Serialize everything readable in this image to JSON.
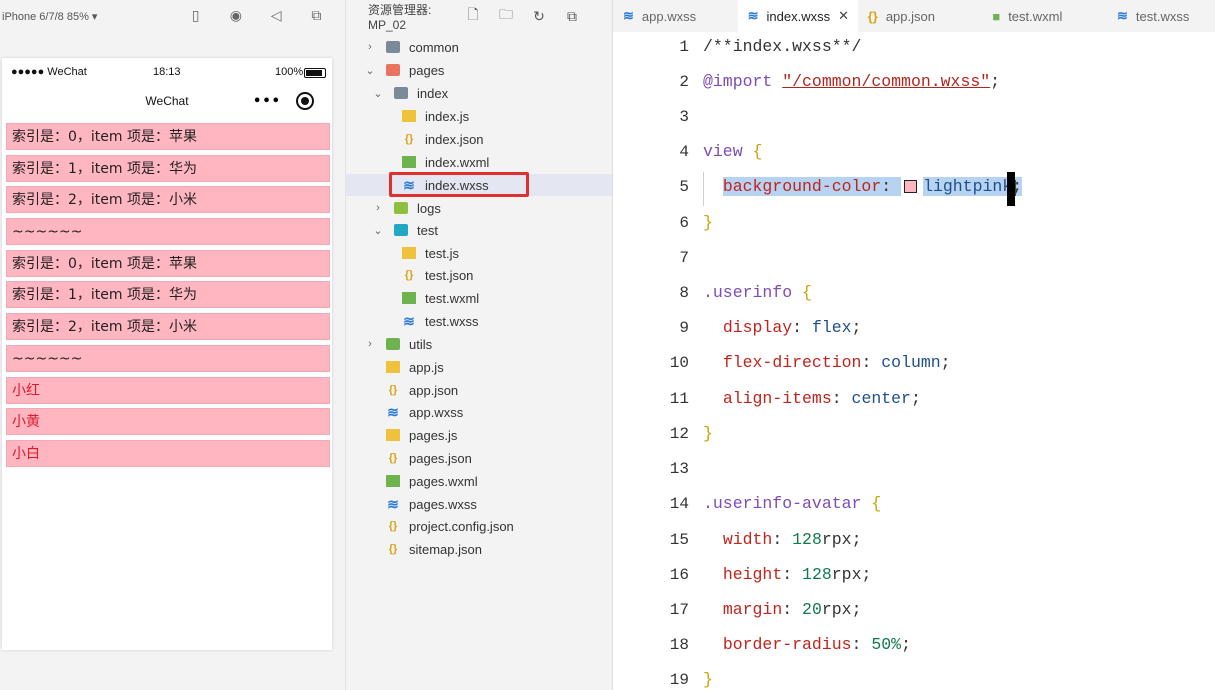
{
  "simulator": {
    "device_label": "iPhone 6/7/8 85% ▾",
    "status": {
      "carrier": "●●●●● WeChat",
      "time": "18:13",
      "battery": "100%"
    },
    "nav_title": "WeChat",
    "items": [
      {
        "text": "索引是：0，item 项是：苹果",
        "red": false
      },
      {
        "text": "索引是：1，item 项是：华为",
        "red": false
      },
      {
        "text": "索引是：2，item 项是：小米",
        "red": false
      },
      {
        "text": "~~~~~~",
        "red": false
      },
      {
        "text": "索引是：0，item 项是：苹果",
        "red": false
      },
      {
        "text": "索引是：1，item 项是：华为",
        "red": false
      },
      {
        "text": "索引是：2，item 项是：小米",
        "red": false
      },
      {
        "text": "~~~~~~",
        "red": false
      },
      {
        "text": "小红",
        "red": true
      },
      {
        "text": "小黄",
        "red": true
      },
      {
        "text": "小白",
        "red": true
      }
    ]
  },
  "explorer": {
    "title": "资源管理器: MP_02",
    "tree": [
      {
        "label": "common",
        "depth": 0,
        "kind": "fold-grey",
        "chev": "›"
      },
      {
        "label": "pages",
        "depth": 0,
        "kind": "fold-pages",
        "chev": "⌄"
      },
      {
        "label": "index",
        "depth": 1,
        "kind": "fold-index",
        "chev": "⌄"
      },
      {
        "label": "index.js",
        "depth": 2,
        "kind": "i-js",
        "chev": ""
      },
      {
        "label": "index.json",
        "depth": 2,
        "kind": "i-json",
        "chev": ""
      },
      {
        "label": "index.wxml",
        "depth": 2,
        "kind": "i-wxml",
        "chev": ""
      },
      {
        "label": "index.wxss",
        "depth": 2,
        "kind": "i-wxss",
        "chev": "",
        "selected": true
      },
      {
        "label": "logs",
        "depth": 1,
        "kind": "fold-logs",
        "chev": "›"
      },
      {
        "label": "test",
        "depth": 1,
        "kind": "fold-test",
        "chev": "⌄"
      },
      {
        "label": "test.js",
        "depth": 2,
        "kind": "i-js",
        "chev": ""
      },
      {
        "label": "test.json",
        "depth": 2,
        "kind": "i-json",
        "chev": ""
      },
      {
        "label": "test.wxml",
        "depth": 2,
        "kind": "i-wxml",
        "chev": ""
      },
      {
        "label": "test.wxss",
        "depth": 2,
        "kind": "i-wxss",
        "chev": ""
      },
      {
        "label": "utils",
        "depth": 0,
        "kind": "fold-utils",
        "chev": "›"
      },
      {
        "label": "app.js",
        "depth": 0,
        "kind": "i-js",
        "chev": ""
      },
      {
        "label": "app.json",
        "depth": 0,
        "kind": "i-json",
        "chev": ""
      },
      {
        "label": "app.wxss",
        "depth": 0,
        "kind": "i-wxss",
        "chev": ""
      },
      {
        "label": "pages.js",
        "depth": 0,
        "kind": "i-js",
        "chev": ""
      },
      {
        "label": "pages.json",
        "depth": 0,
        "kind": "i-json",
        "chev": ""
      },
      {
        "label": "pages.wxml",
        "depth": 0,
        "kind": "i-wxml",
        "chev": ""
      },
      {
        "label": "pages.wxss",
        "depth": 0,
        "kind": "i-wxss",
        "chev": ""
      },
      {
        "label": "project.config.json",
        "depth": 0,
        "kind": "i-json",
        "chev": ""
      },
      {
        "label": "sitemap.json",
        "depth": 0,
        "kind": "i-json",
        "chev": ""
      }
    ]
  },
  "editor": {
    "tabs": [
      {
        "label": "app.wxss",
        "icon": "wxss",
        "active": false
      },
      {
        "label": "index.wxss",
        "icon": "wxss",
        "active": true,
        "close": "✕"
      },
      {
        "label": "app.json",
        "icon": "json",
        "active": false
      },
      {
        "label": "test.wxml",
        "icon": "wxml",
        "active": false
      },
      {
        "label": "test.wxss",
        "icon": "wxss",
        "active": false
      }
    ],
    "lines": [
      [
        {
          "t": "/**index.wxss**/",
          "c": "cm"
        }
      ],
      [
        {
          "t": "@import",
          "c": "kw"
        },
        {
          "t": " ",
          "c": ""
        },
        {
          "t": "\"/common/common.wxss\"",
          "c": "str"
        },
        {
          "t": ";",
          "c": ""
        }
      ],
      [],
      [
        {
          "t": "view",
          "c": "sel"
        },
        {
          "t": " ",
          "c": ""
        },
        {
          "t": "{",
          "c": "brace"
        }
      ],
      [
        {
          "t": "  ",
          "c": ""
        },
        {
          "t": "background-color",
          "c": "prop hl"
        },
        {
          "t": ": ",
          "c": "hl"
        },
        {
          "t": "",
          "c": "swatch"
        },
        {
          "t": "lightpink",
          "c": "val hl"
        },
        {
          "t": ";",
          "c": "hl"
        }
      ],
      [
        {
          "t": "}",
          "c": "brace"
        }
      ],
      [],
      [
        {
          "t": ".userinfo",
          "c": "sel"
        },
        {
          "t": " ",
          "c": ""
        },
        {
          "t": "{",
          "c": "brace"
        }
      ],
      [
        {
          "t": "  ",
          "c": ""
        },
        {
          "t": "display",
          "c": "prop"
        },
        {
          "t": ": ",
          "c": ""
        },
        {
          "t": "flex",
          "c": "val"
        },
        {
          "t": ";",
          "c": ""
        }
      ],
      [
        {
          "t": "  ",
          "c": ""
        },
        {
          "t": "flex-direction",
          "c": "prop"
        },
        {
          "t": ": ",
          "c": ""
        },
        {
          "t": "column",
          "c": "val"
        },
        {
          "t": ";",
          "c": ""
        }
      ],
      [
        {
          "t": "  ",
          "c": ""
        },
        {
          "t": "align-items",
          "c": "prop"
        },
        {
          "t": ": ",
          "c": ""
        },
        {
          "t": "center",
          "c": "val"
        },
        {
          "t": ";",
          "c": ""
        }
      ],
      [
        {
          "t": "}",
          "c": "brace"
        }
      ],
      [],
      [
        {
          "t": ".userinfo-avatar",
          "c": "sel"
        },
        {
          "t": " ",
          "c": ""
        },
        {
          "t": "{",
          "c": "brace"
        }
      ],
      [
        {
          "t": "  ",
          "c": ""
        },
        {
          "t": "width",
          "c": "prop"
        },
        {
          "t": ": ",
          "c": ""
        },
        {
          "t": "128",
          "c": "num"
        },
        {
          "t": "rpx;",
          "c": ""
        }
      ],
      [
        {
          "t": "  ",
          "c": ""
        },
        {
          "t": "height",
          "c": "prop"
        },
        {
          "t": ": ",
          "c": ""
        },
        {
          "t": "128",
          "c": "num"
        },
        {
          "t": "rpx;",
          "c": ""
        }
      ],
      [
        {
          "t": "  ",
          "c": ""
        },
        {
          "t": "margin",
          "c": "prop"
        },
        {
          "t": ": ",
          "c": ""
        },
        {
          "t": "20",
          "c": "num"
        },
        {
          "t": "rpx;",
          "c": ""
        }
      ],
      [
        {
          "t": "  ",
          "c": ""
        },
        {
          "t": "border-radius",
          "c": "prop"
        },
        {
          "t": ": ",
          "c": ""
        },
        {
          "t": "50%",
          "c": "num"
        },
        {
          "t": ";",
          "c": ""
        }
      ],
      [
        {
          "t": "}",
          "c": "brace"
        }
      ]
    ]
  }
}
